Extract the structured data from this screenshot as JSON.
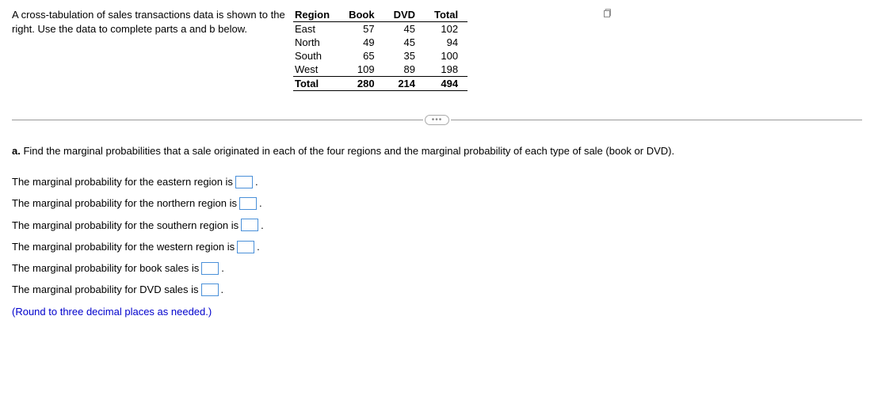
{
  "intro": "A cross-tabulation of sales transactions data is shown to the right. Use the data to complete parts a and b below.",
  "table": {
    "headers": [
      "Region",
      "Book",
      "DVD",
      "Total"
    ],
    "rows": [
      {
        "region": "East",
        "book": "57",
        "dvd": "45",
        "total": "102"
      },
      {
        "region": "North",
        "book": "49",
        "dvd": "45",
        "total": "94"
      },
      {
        "region": "South",
        "book": "65",
        "dvd": "35",
        "total": "100"
      },
      {
        "region": "West",
        "book": "109",
        "dvd": "89",
        "total": "198"
      }
    ],
    "total_row": {
      "region": "Total",
      "book": "280",
      "dvd": "214",
      "total": "494"
    }
  },
  "divider_label": "•••",
  "question_a": {
    "label": "a.",
    "text": " Find the marginal probabilities that a sale originated in each of the four regions and the marginal probability of each type of sale (book or DVD)."
  },
  "answers": {
    "line1a": "The marginal probability for the eastern region is ",
    "line1b": ".",
    "line2a": "The marginal probability for the northern region is ",
    "line2b": ".",
    "line3a": "The marginal probability for the southern region is ",
    "line3b": ".",
    "line4a": "The marginal probability for the western region is ",
    "line4b": ".",
    "line5a": "The marginal probability for book sales is ",
    "line5b": ".",
    "line6a": "The marginal probability for DVD sales is ",
    "line6b": "."
  },
  "round_note": "(Round to three decimal places as needed.)"
}
